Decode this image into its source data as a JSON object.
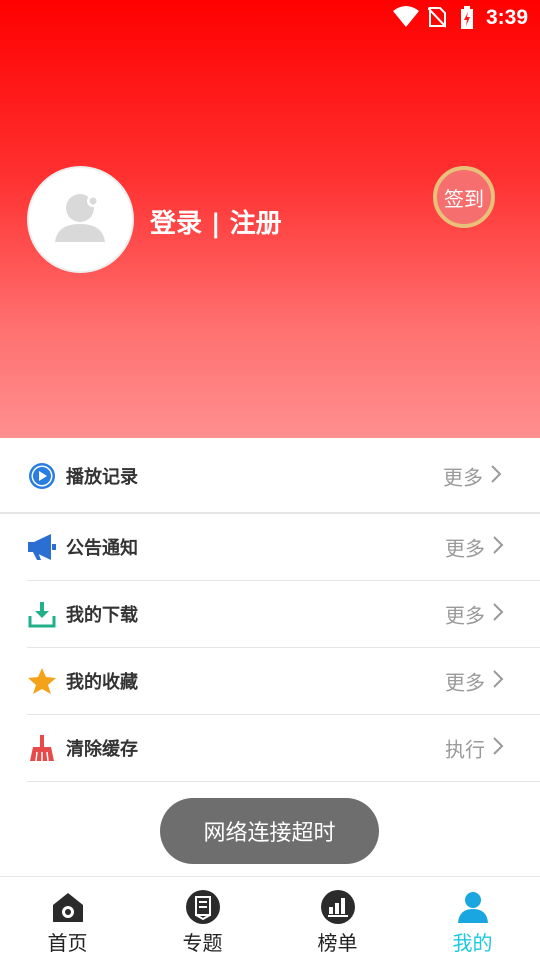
{
  "status_bar": {
    "time": "3:39",
    "icons": [
      "wifi-icon",
      "no-sim-icon",
      "battery-charging-icon"
    ]
  },
  "profile": {
    "login_register": "登录 | 注册",
    "sign_in": "签到",
    "avatar_icon": "user-placeholder-icon"
  },
  "menu": [
    {
      "label": "播放记录",
      "action": "更多",
      "icon": "play-icon",
      "color": "#2a7de1"
    },
    {
      "label": "公告通知",
      "action": "更多",
      "icon": "megaphone-icon",
      "color": "#2a6fd1"
    },
    {
      "label": "我的下载",
      "action": "更多",
      "icon": "download-icon",
      "color": "#22b08a"
    },
    {
      "label": "我的收藏",
      "action": "更多",
      "icon": "star-icon",
      "color": "#f5a21b"
    },
    {
      "label": "清除缓存",
      "action": "执行",
      "icon": "broom-icon",
      "color": "#e84a4a"
    }
  ],
  "toast": "网络连接超时",
  "tabs": [
    {
      "label": "首页",
      "icon": "home-icon",
      "active": false
    },
    {
      "label": "专题",
      "icon": "topic-icon",
      "active": false
    },
    {
      "label": "榜单",
      "icon": "chart-icon",
      "active": false
    },
    {
      "label": "我的",
      "icon": "user-icon",
      "active": true
    }
  ],
  "colors": {
    "header_top": "#ff0000",
    "header_bottom": "#ff8f8f",
    "active_tab": "#1ec9e0",
    "toast_bg": "#6e6e6e"
  }
}
